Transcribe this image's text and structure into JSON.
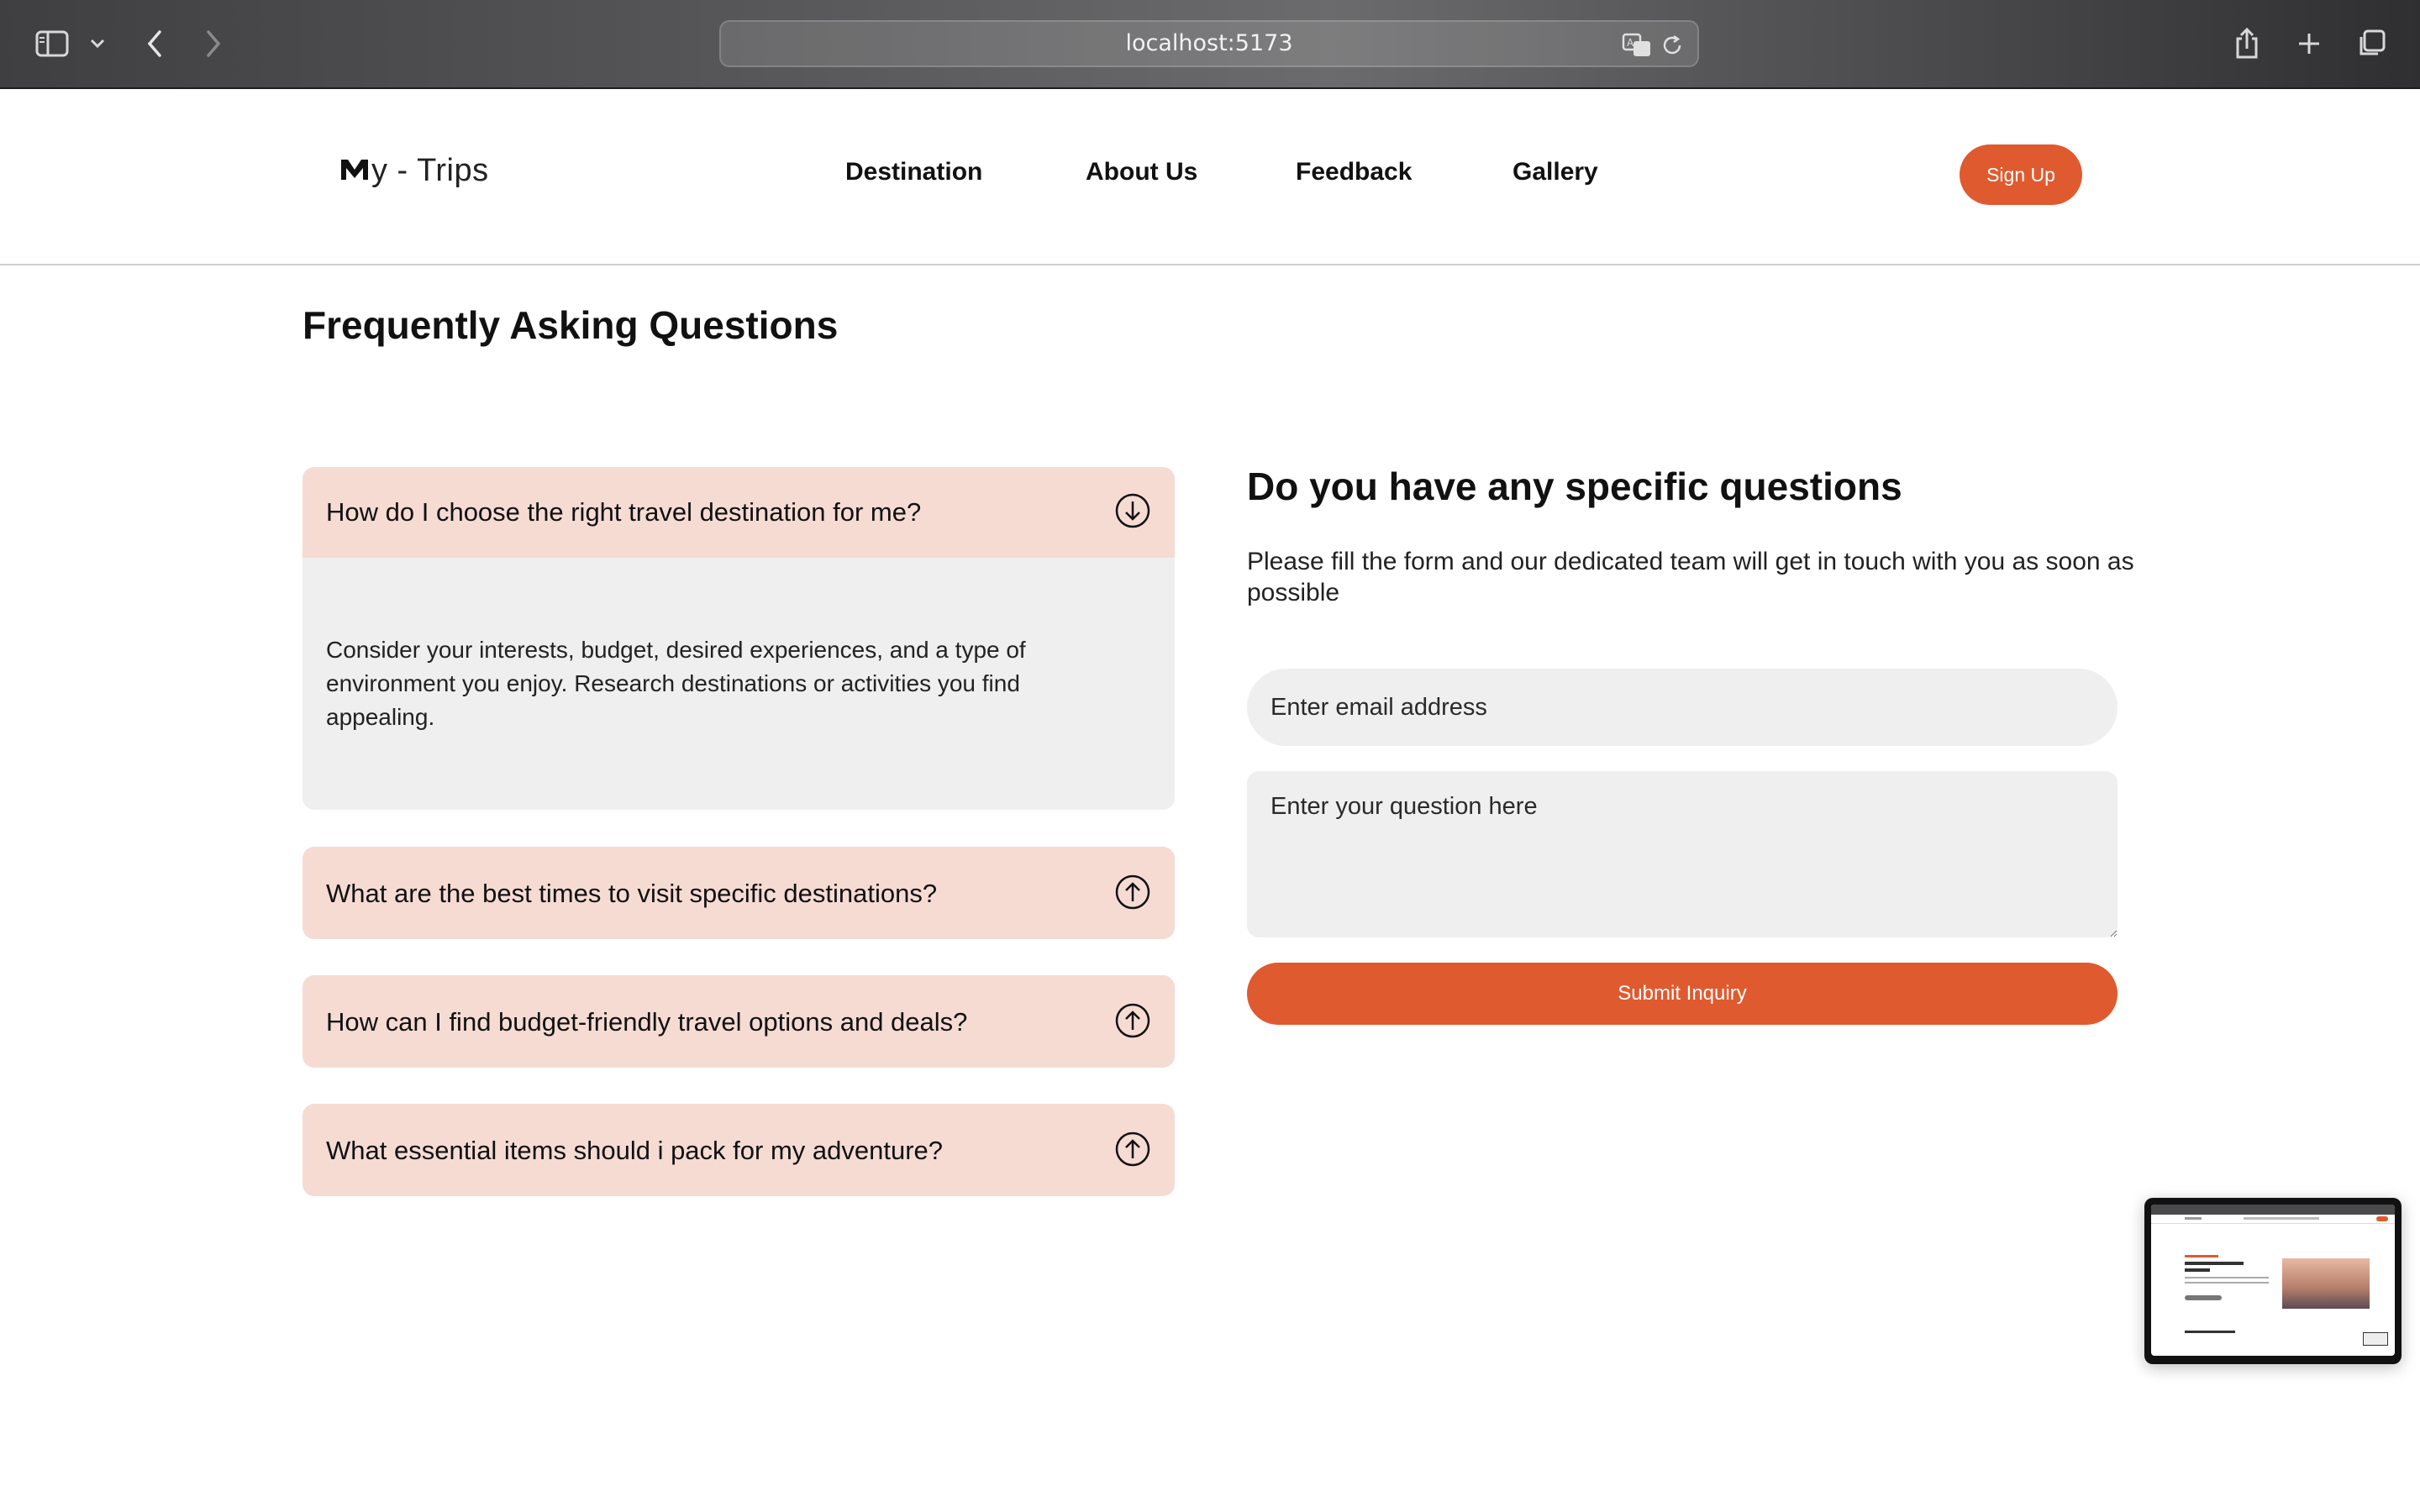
{
  "browser": {
    "url": "localhost:5173",
    "icons": [
      "sidebar-icon",
      "chevron-down-icon",
      "back-icon",
      "forward-icon",
      "translate-icon",
      "reload-icon",
      "share-icon",
      "new-tab-icon",
      "tabs-overview-icon"
    ]
  },
  "header": {
    "logo_text": "y - Trips",
    "nav": [
      "Destination",
      "About Us",
      "Feedback",
      "Gallery"
    ],
    "signup_label": "Sign Up",
    "accent_color": "#e05a2f"
  },
  "faq": {
    "title": "Frequently Asking Questions",
    "items": [
      {
        "question": "How do I choose the right travel destination for me?",
        "answer": "Consider your interests, budget, desired experiences, and a type of environment you enjoy. Research destinations or activities you find appealing.",
        "expanded": true
      },
      {
        "question": "What are the best times to visit specific destinations?",
        "expanded": false
      },
      {
        "question": "How can I find budget-friendly travel options and deals?",
        "expanded": false
      },
      {
        "question": "What essential items should i pack for my adventure?",
        "expanded": false
      }
    ],
    "item_color": "#f6dbd3",
    "answer_bg": "#efefef"
  },
  "form": {
    "title": "Do you have any specific questions",
    "description": "Please fill the form and our dedicated team will get in touch with you as soon as possible",
    "email_placeholder": "Enter email address",
    "question_placeholder": "Enter your question here",
    "submit_label": "Submit Inquiry"
  }
}
